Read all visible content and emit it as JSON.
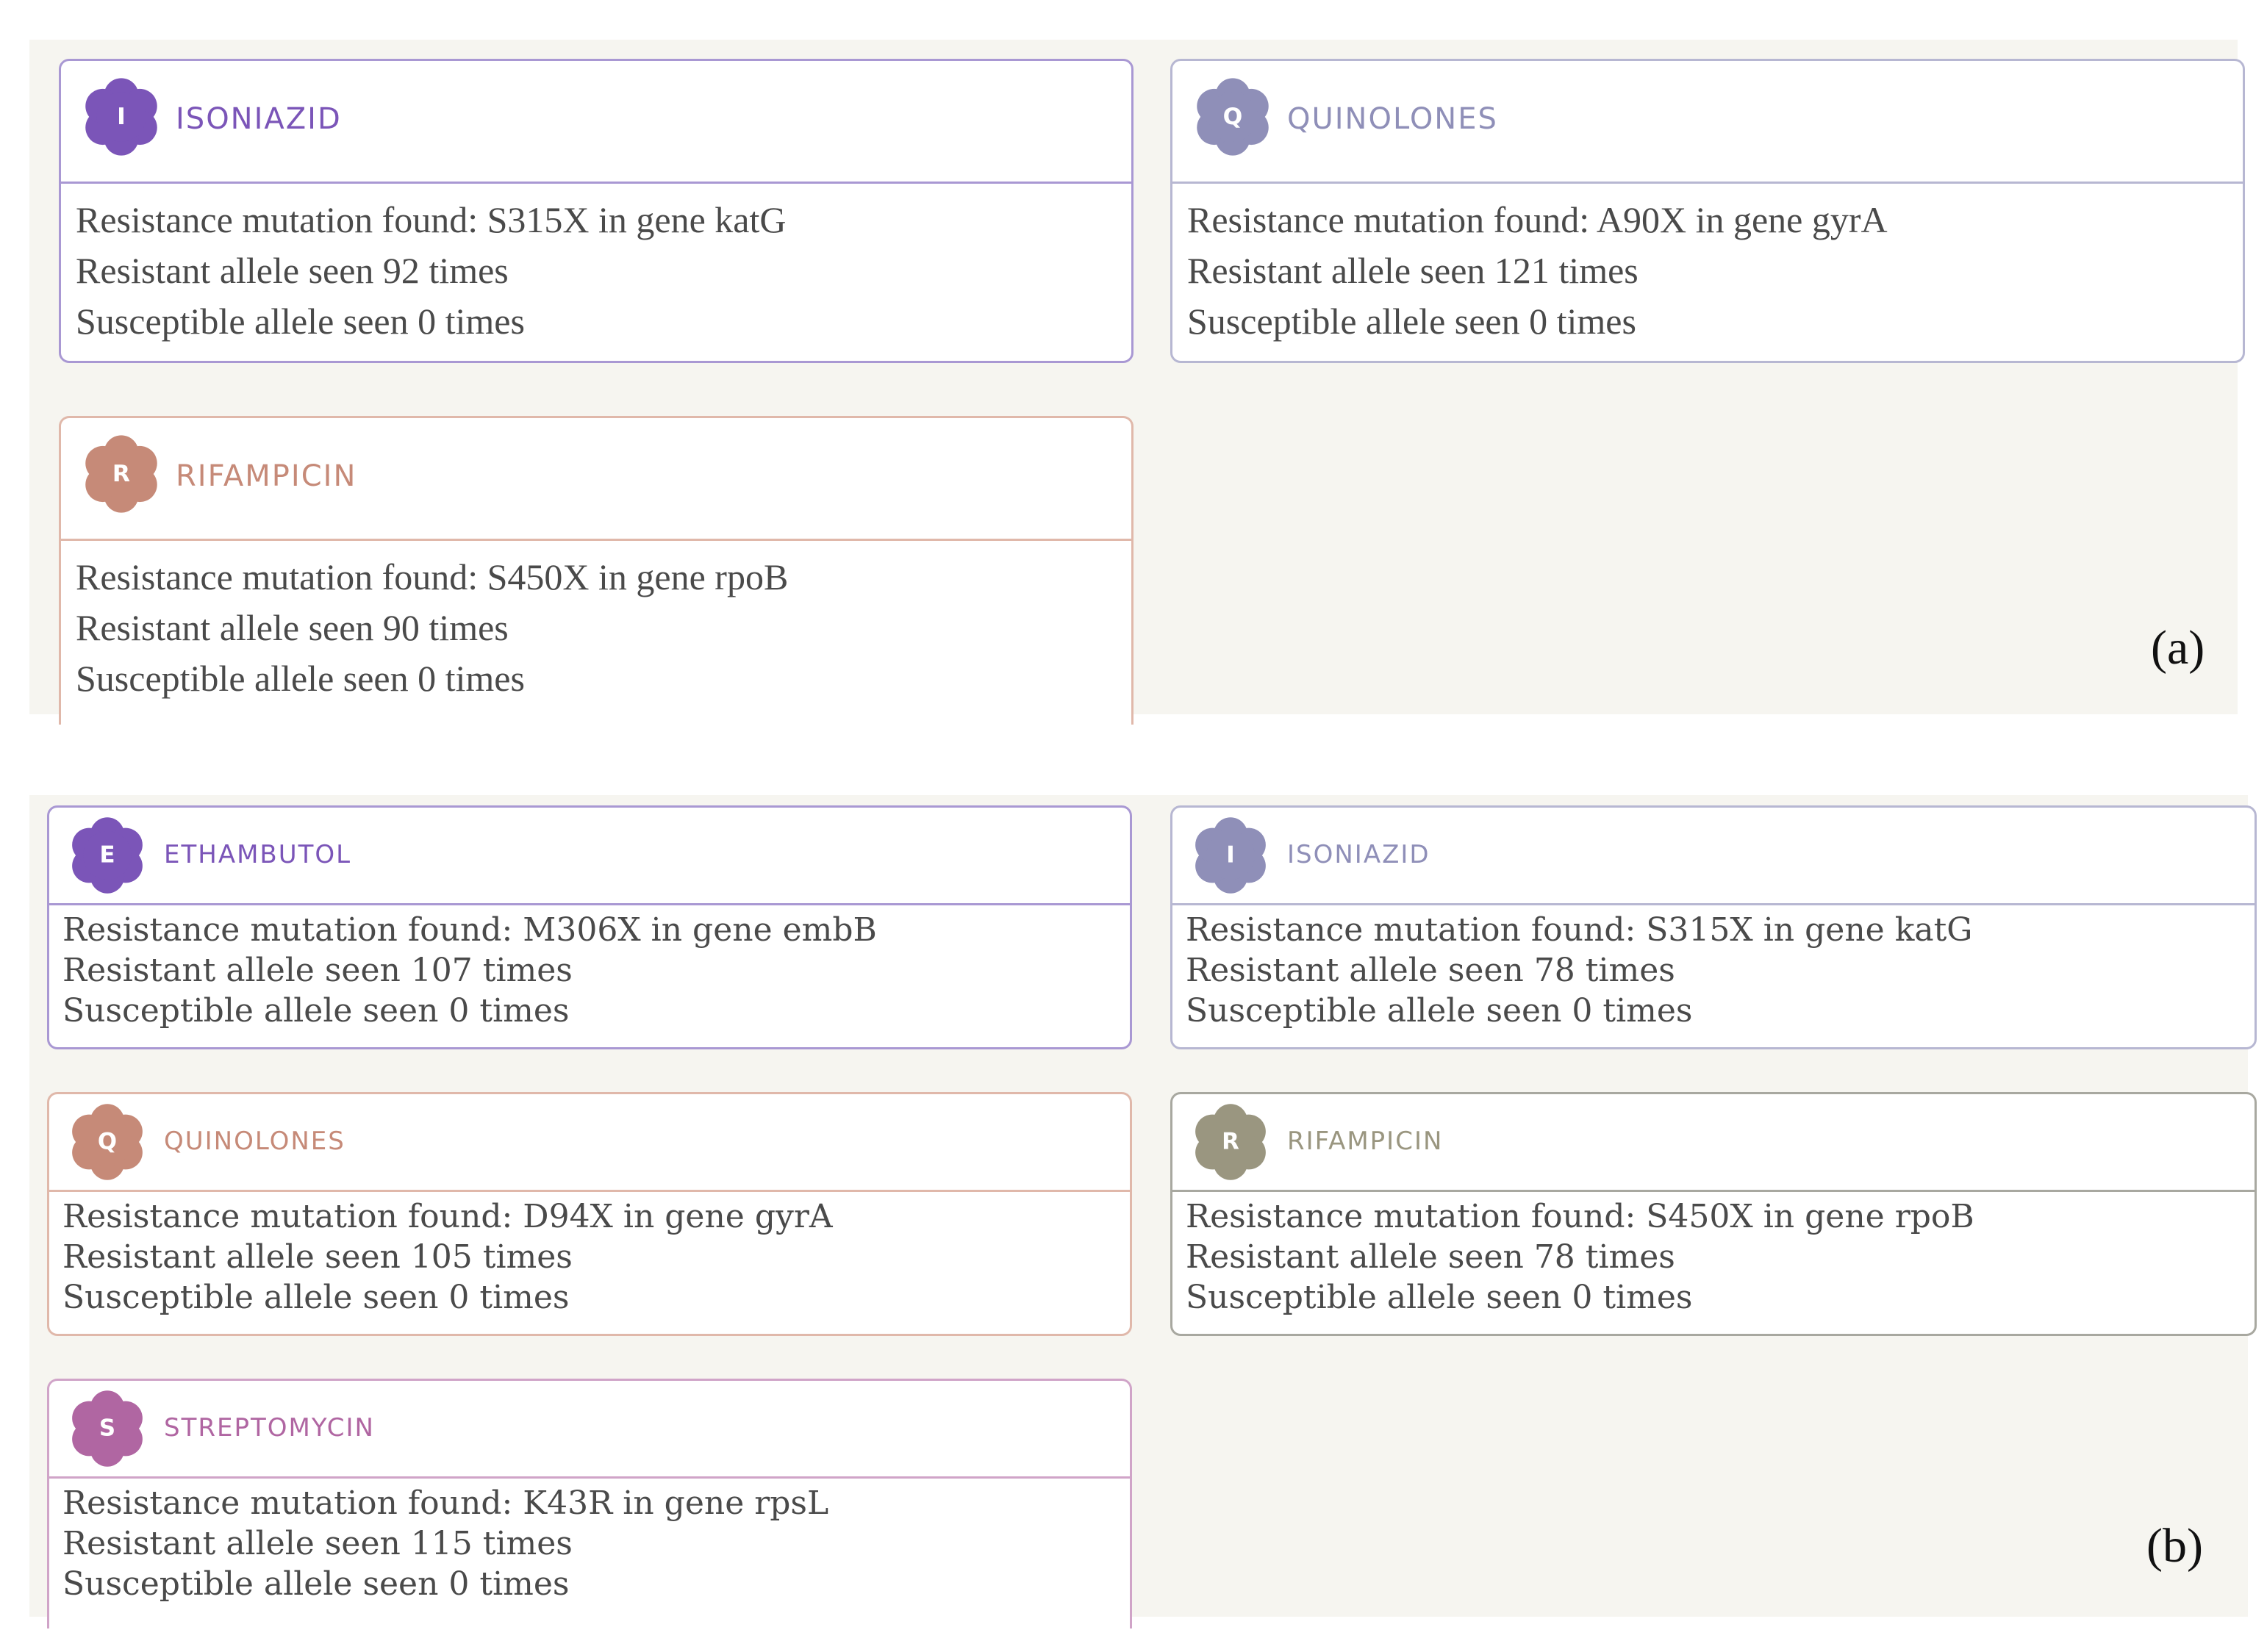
{
  "panel_a": {
    "label": "(a)",
    "cards": [
      {
        "letter": "I",
        "drug": "ISONIAZID",
        "color": "#7b55b8",
        "border": "#a998d3",
        "mutation": "Resistance mutation found: S315X in gene katG",
        "resistant": "Resistant allele seen 92 times",
        "susceptible": "Susceptible allele seen 0 times"
      },
      {
        "letter": "Q",
        "drug": "QUINOLONES",
        "color": "#8f8fb8",
        "border": "#b7b7d2",
        "mutation": "Resistance mutation found: A90X in gene gyrA",
        "resistant": "Resistant allele seen 121 times",
        "susceptible": "Susceptible allele seen 0 times"
      },
      {
        "letter": "R",
        "drug": "RIFAMPICIN",
        "color": "#c68a78",
        "border": "#e0b8aa",
        "mutation": "Resistance mutation found: S450X in gene rpoB",
        "resistant": "Resistant allele seen 90 times",
        "susceptible": "Susceptible allele seen 0 times"
      }
    ]
  },
  "panel_b": {
    "label": "(b)",
    "cards": [
      {
        "letter": "E",
        "drug": "ETHAMBUTOL",
        "color": "#7b55b8",
        "border": "#a998d3",
        "mutation": "Resistance mutation found: M306X in gene embB",
        "resistant": "Resistant allele seen 107 times",
        "susceptible": "Susceptible allele seen 0 times"
      },
      {
        "letter": "I",
        "drug": "ISONIAZID",
        "color": "#8f8fb8",
        "border": "#b7b7d2",
        "mutation": "Resistance mutation found: S315X in gene katG",
        "resistant": "Resistant allele seen 78 times",
        "susceptible": "Susceptible allele seen 0 times"
      },
      {
        "letter": "Q",
        "drug": "QUINOLONES",
        "color": "#c68a78",
        "border": "#e0b8aa",
        "mutation": "Resistance mutation found: D94X in gene gyrA",
        "resistant": "Resistant allele seen 105 times",
        "susceptible": "Susceptible allele seen 0 times"
      },
      {
        "letter": "R",
        "drug": "RIFAMPICIN",
        "color": "#9a9680",
        "border": "#a8a8a0",
        "mutation": "Resistance mutation found: S450X in gene rpoB",
        "resistant": "Resistant allele seen 78 times",
        "susceptible": "Susceptible allele seen 0 times"
      },
      {
        "letter": "S",
        "drug": "STREPTOMYCIN",
        "color": "#b066a2",
        "border": "#d0a4c8",
        "mutation": "Resistance mutation found: K43R in gene rpsL",
        "resistant": "Resistant allele seen 115 times",
        "susceptible": "Susceptible allele seen 0 times"
      }
    ]
  }
}
